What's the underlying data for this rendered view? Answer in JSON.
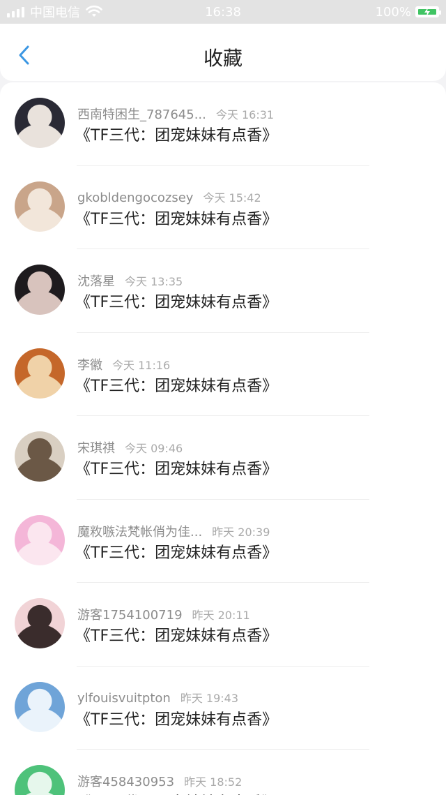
{
  "status_bar": {
    "carrier": "中国电信",
    "time": "16:38",
    "battery_percent": "100%"
  },
  "nav": {
    "title": "收藏",
    "back_icon": "chevron-left-icon"
  },
  "favorites": [
    {
      "name": "西南特困生_787645...",
      "time": "今天 16:31",
      "title": "《TF三代：团宠妹妹有点香》",
      "avatar_color_a": "#2a2a35",
      "avatar_color_b": "#e9e2dc"
    },
    {
      "name": "gkobldengocozsey",
      "time": "今天 15:42",
      "title": "《TF三代：团宠妹妹有点香》",
      "avatar_color_a": "#c9a58a",
      "avatar_color_b": "#f2e6da"
    },
    {
      "name": "沈落星",
      "time": "今天 13:35",
      "title": "《TF三代：团宠妹妹有点香》",
      "avatar_color_a": "#1e1b1e",
      "avatar_color_b": "#d8c3bd"
    },
    {
      "name": "李徽",
      "time": "今天 11:16",
      "title": "《TF三代：团宠妹妹有点香》",
      "avatar_color_a": "#c5672a",
      "avatar_color_b": "#f0d2a8"
    },
    {
      "name": "宋琪祺",
      "time": "今天 09:46",
      "title": "《TF三代：团宠妹妹有点香》",
      "avatar_color_a": "#d9cfc2",
      "avatar_color_b": "#6b5846"
    },
    {
      "name": "魔敉嗾法梵帐俏为佳...",
      "time": "昨天 20:39",
      "title": "《TF三代：团宠妹妹有点香》",
      "avatar_color_a": "#f4b6d8",
      "avatar_color_b": "#fbe6ef"
    },
    {
      "name": "游客1754100719",
      "time": "昨天 20:11",
      "title": "《TF三代：团宠妹妹有点香》",
      "avatar_color_a": "#f1d3d6",
      "avatar_color_b": "#3a2c2c"
    },
    {
      "name": "ylfouisvuitpton",
      "time": "昨天 19:43",
      "title": "《TF三代：团宠妹妹有点香》",
      "avatar_color_a": "#6fa4d8",
      "avatar_color_b": "#eaf3fb"
    },
    {
      "name": "游客458430953",
      "time": "昨天 18:52",
      "title": "《TF三代：团宠妹妹有点香》",
      "avatar_color_a": "#4ec27a",
      "avatar_color_b": "#e6f7ec"
    }
  ]
}
